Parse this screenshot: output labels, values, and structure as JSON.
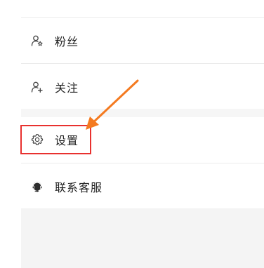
{
  "menu": {
    "items": [
      {
        "label": "粉丝",
        "icon": "fans-icon"
      },
      {
        "label": "关注",
        "icon": "follow-icon"
      },
      {
        "label": "设置",
        "icon": "settings-gear-icon"
      },
      {
        "label": "联系客服",
        "icon": "customer-service-icon"
      }
    ]
  },
  "annotation": {
    "highlight_color": "#e8312f",
    "arrow_color": "#f47a20"
  }
}
